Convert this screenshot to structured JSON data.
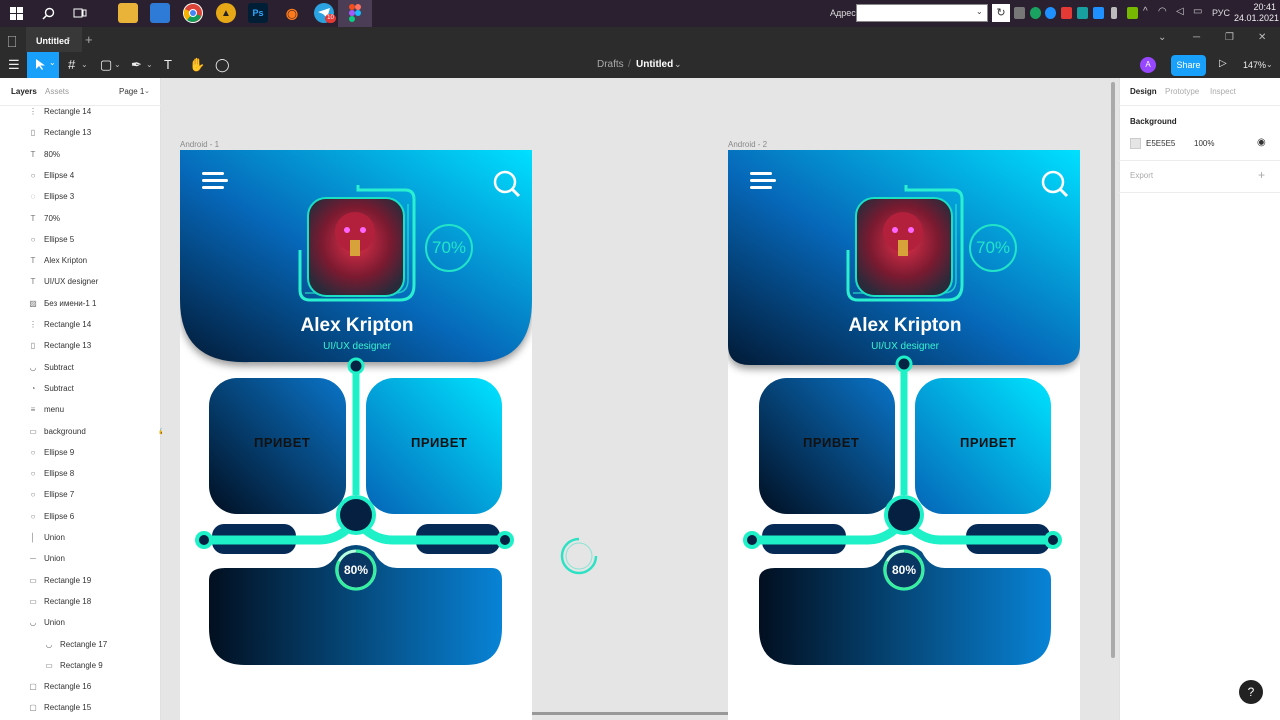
{
  "taskbar": {
    "address_label": "Адрес",
    "address_value": "",
    "lang": "РУС",
    "time": "20:41",
    "date": "24.01.2021",
    "badge_count": "10"
  },
  "figma": {
    "tab_title": "Untitled",
    "breadcrumb": "Drafts",
    "separator": "/",
    "file_name": "Untitled",
    "avatar_letter": "A",
    "share_label": "Share",
    "zoom": "147%"
  },
  "layers_panel": {
    "tab_layers": "Layers",
    "tab_assets": "Assets",
    "page": "Page 1",
    "items": [
      {
        "icon": "⋮",
        "name": "Rectangle 14"
      },
      {
        "icon": "▯",
        "name": "Rectangle 13"
      },
      {
        "icon": "T",
        "name": "80%"
      },
      {
        "icon": "○",
        "name": "Ellipse 4"
      },
      {
        "icon": "◌",
        "name": "Ellipse 3"
      },
      {
        "icon": "T",
        "name": "70%"
      },
      {
        "icon": "○",
        "name": "Ellipse 5"
      },
      {
        "icon": "T",
        "name": "Alex Kripton"
      },
      {
        "icon": "T",
        "name": "UI/UX designer"
      },
      {
        "icon": "▨",
        "name": "Без имени-1 1"
      },
      {
        "icon": "⋮",
        "name": "Rectangle 14"
      },
      {
        "icon": "▯",
        "name": "Rectangle 13"
      },
      {
        "icon": "◡",
        "name": "Subtract"
      },
      {
        "icon": "◔",
        "name": "Subtract"
      },
      {
        "icon": "≡",
        "name": "menu"
      },
      {
        "icon": "▭",
        "name": "background",
        "locked": true
      },
      {
        "icon": "○",
        "name": "Ellipse 9"
      },
      {
        "icon": "○",
        "name": "Ellipse 8"
      },
      {
        "icon": "○",
        "name": "Ellipse 7"
      },
      {
        "icon": "○",
        "name": "Ellipse 6"
      },
      {
        "icon": "│",
        "name": "Union"
      },
      {
        "icon": "─",
        "name": "Union"
      },
      {
        "icon": "▭",
        "name": "Rectangle 19"
      },
      {
        "icon": "▭",
        "name": "Rectangle 18"
      },
      {
        "icon": "◡",
        "name": "Union"
      },
      {
        "icon": "◡",
        "name": "Rectangle 17",
        "indent": true
      },
      {
        "icon": "▭",
        "name": "Rectangle 9",
        "indent": true
      },
      {
        "icon": "▢",
        "name": "Rectangle 16"
      },
      {
        "icon": "▢",
        "name": "Rectangle 15"
      }
    ]
  },
  "design_panel": {
    "tab_design": "Design",
    "tab_prototype": "Prototype",
    "tab_inspect": "Inspect",
    "background_label": "Background",
    "background_hex": "E5E5E5",
    "background_opacity": "100%",
    "export_label": "Export"
  },
  "canvas": {
    "frames": [
      {
        "label": "Android - 1",
        "name": "Alex Kripton",
        "role": "UI/UX designer",
        "percent_top": "70%",
        "percent_bottom": "80%",
        "card_left": "ПРИВЕТ",
        "card_right": "ПРИВЕТ"
      },
      {
        "label": "Android - 2",
        "name": "Alex Kripton",
        "role": "UI/UX designer",
        "percent_top": "70%",
        "percent_bottom": "80%",
        "card_left": "ПРИВЕТ",
        "card_right": "ПРИВЕТ"
      }
    ]
  },
  "colors": {
    "accent": "#18a0fb",
    "neon": "#22f0c4",
    "dark_navy": "#04213f",
    "cyan": "#00e6ff"
  }
}
